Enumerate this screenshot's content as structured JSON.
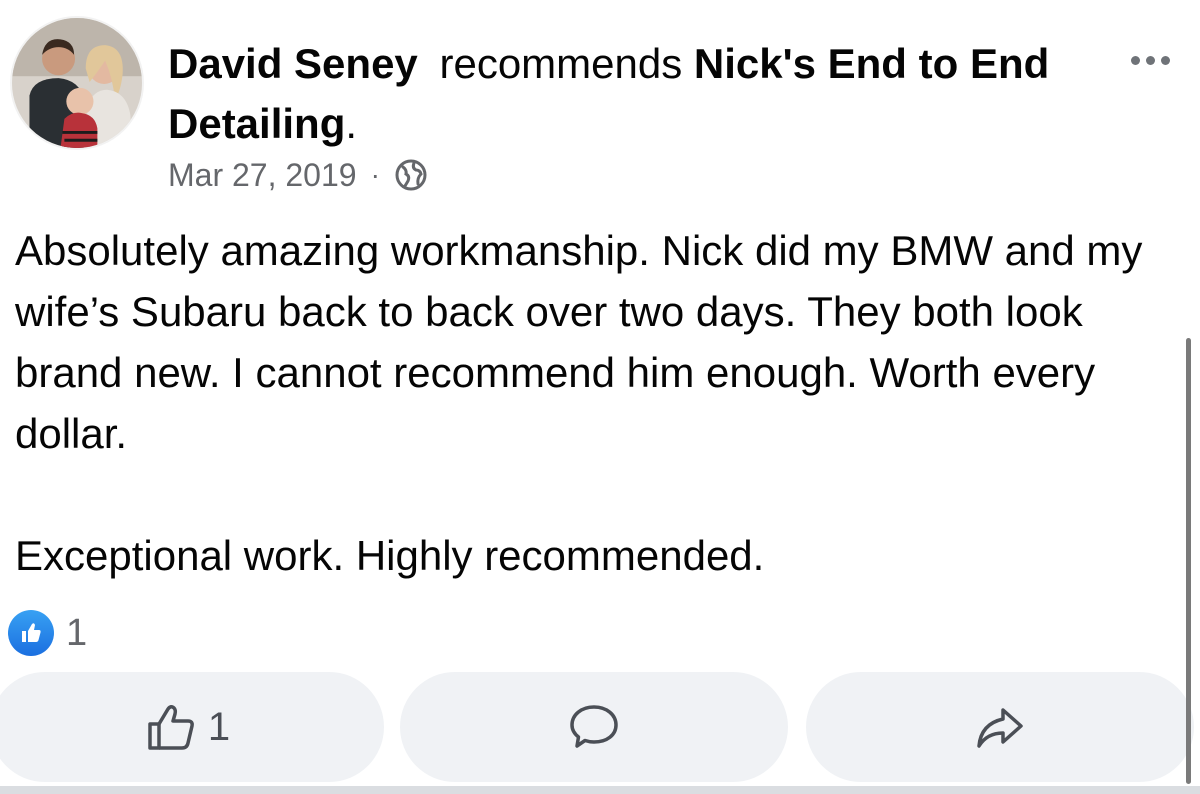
{
  "post": {
    "author": "David Seney",
    "verb": "recommends",
    "page_name": "Nick's End to End Detailing",
    "period": ".",
    "date": "Mar 27, 2019",
    "separator": "·",
    "privacy_icon": "globe-icon",
    "paragraphs": [
      "Absolutely amazing workmanship. Nick did my BMW and my wife’s Subaru back to back over two days. They both look brand new. I cannot recommend him enough. Worth every dollar.",
      "Exceptional work. Highly recommended."
    ]
  },
  "reactions": {
    "icon": "like-icon",
    "count": "1"
  },
  "actions": {
    "like_icon": "thumbs-up-icon",
    "like_count": "1",
    "comment_icon": "comment-bubble-icon",
    "share_icon": "share-arrow-icon"
  },
  "colors": {
    "text": "#050505",
    "secondary": "#65676b",
    "button_bg": "#f0f2f5",
    "like_blue": "#1b74e4"
  }
}
